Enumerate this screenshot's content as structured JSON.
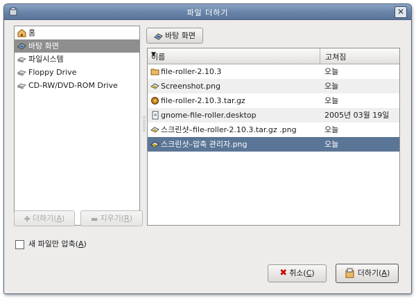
{
  "window": {
    "title": "파일 더하기"
  },
  "places": [
    {
      "label": "홈",
      "icon": "home-folder-icon",
      "selected": false
    },
    {
      "label": "바탕 화면",
      "icon": "desktop-icon",
      "selected": true
    },
    {
      "label": "파일시스템",
      "icon": "harddisk-icon",
      "selected": false
    },
    {
      "label": "Floppy Drive",
      "icon": "floppy-drive-icon",
      "selected": false
    },
    {
      "label": "CD-RW/DVD-ROM Drive",
      "icon": "cdrom-drive-icon",
      "selected": false
    }
  ],
  "path_button": {
    "label": "바탕 화면"
  },
  "columns": {
    "name": "이름",
    "modified": "고쳐짐"
  },
  "files": [
    {
      "name": "file-roller-2.10.3",
      "modified": "오늘",
      "icon": "folder-icon"
    },
    {
      "name": "Screenshot.png",
      "modified": "오늘",
      "icon": "image-file-icon"
    },
    {
      "name": "file-roller-2.10.3.tar.gz",
      "modified": "오늘",
      "icon": "archive-file-icon"
    },
    {
      "name": "gnome-file-roller.desktop",
      "modified": "2005년 03월 19일",
      "icon": "desktop-file-icon"
    },
    {
      "name": "스크린샷–file-roller-2.10.3.tar.gz .png",
      "modified": "오늘",
      "icon": "image-file-icon"
    },
    {
      "name": "스크린샷–압축 관리자.png",
      "modified": "오늘",
      "icon": "image-file-icon"
    }
  ],
  "selected_file_index": 5,
  "buttons": {
    "add_place": {
      "label": "더하기(",
      "mnemonic": "A",
      "suffix": ")"
    },
    "remove_place": {
      "label": "지우기(",
      "mnemonic": "R",
      "suffix": ")"
    },
    "cancel": {
      "label": "취소(",
      "mnemonic": "C",
      "suffix": ")"
    },
    "add": {
      "label": "더하기(",
      "mnemonic": "A",
      "suffix": ")"
    }
  },
  "checkbox": {
    "label": "새 파일만 압축(",
    "mnemonic": "A",
    "suffix": ")",
    "checked": false
  },
  "colors": {
    "titlebar": "#6783a8",
    "selection": "#5a7596",
    "place_selection": "#8e8e8e"
  }
}
